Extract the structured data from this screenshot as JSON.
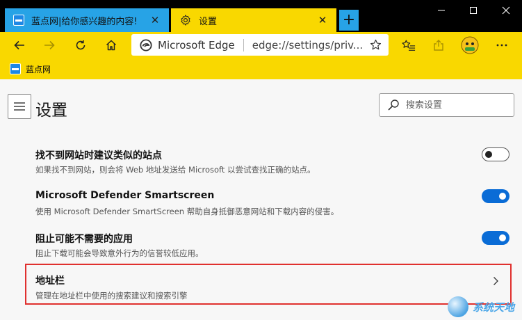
{
  "tabs": [
    {
      "title": "蓝点网|给你感兴趣的内容!",
      "close": "✕",
      "active": false
    },
    {
      "title": "设置",
      "close": "✕",
      "active": true
    }
  ],
  "new_tab_label": "+",
  "window_controls": {
    "minimize": "—",
    "maximize": "☐",
    "close": "✕"
  },
  "address_bar": {
    "site": "Microsoft Edge",
    "url": "edge://settings/priv..."
  },
  "favorites": [
    {
      "label": "蓝点网"
    }
  ],
  "settings": {
    "title": "设置",
    "search_placeholder": "搜索设置",
    "rows": [
      {
        "title": "找不到网站时建议类似的站点",
        "desc": "如果找不到网站，则会将 Web 地址发送给 Microsoft 以尝试查找正确的站点。",
        "toggle": false
      },
      {
        "title": "Microsoft Defender Smartscreen",
        "desc": "使用 Microsoft Defender SmartScreen 帮助自身抵御恶意网站和下载内容的侵害。",
        "toggle": true
      },
      {
        "title": "阻止可能不需要的应用",
        "desc": "阻止下载可能会导致意外行为的信誉较低应用。",
        "toggle": true
      },
      {
        "title": "地址栏",
        "desc": "管理在地址栏中使用的搜索建议和搜索引擎"
      }
    ]
  },
  "watermark": {
    "text": "系统天地"
  },
  "colors": {
    "toolbar": "#f9d800",
    "tab_inactive": "#27a3e6",
    "toggle_on": "#0a6cd6",
    "highlight": "#e0302e"
  }
}
